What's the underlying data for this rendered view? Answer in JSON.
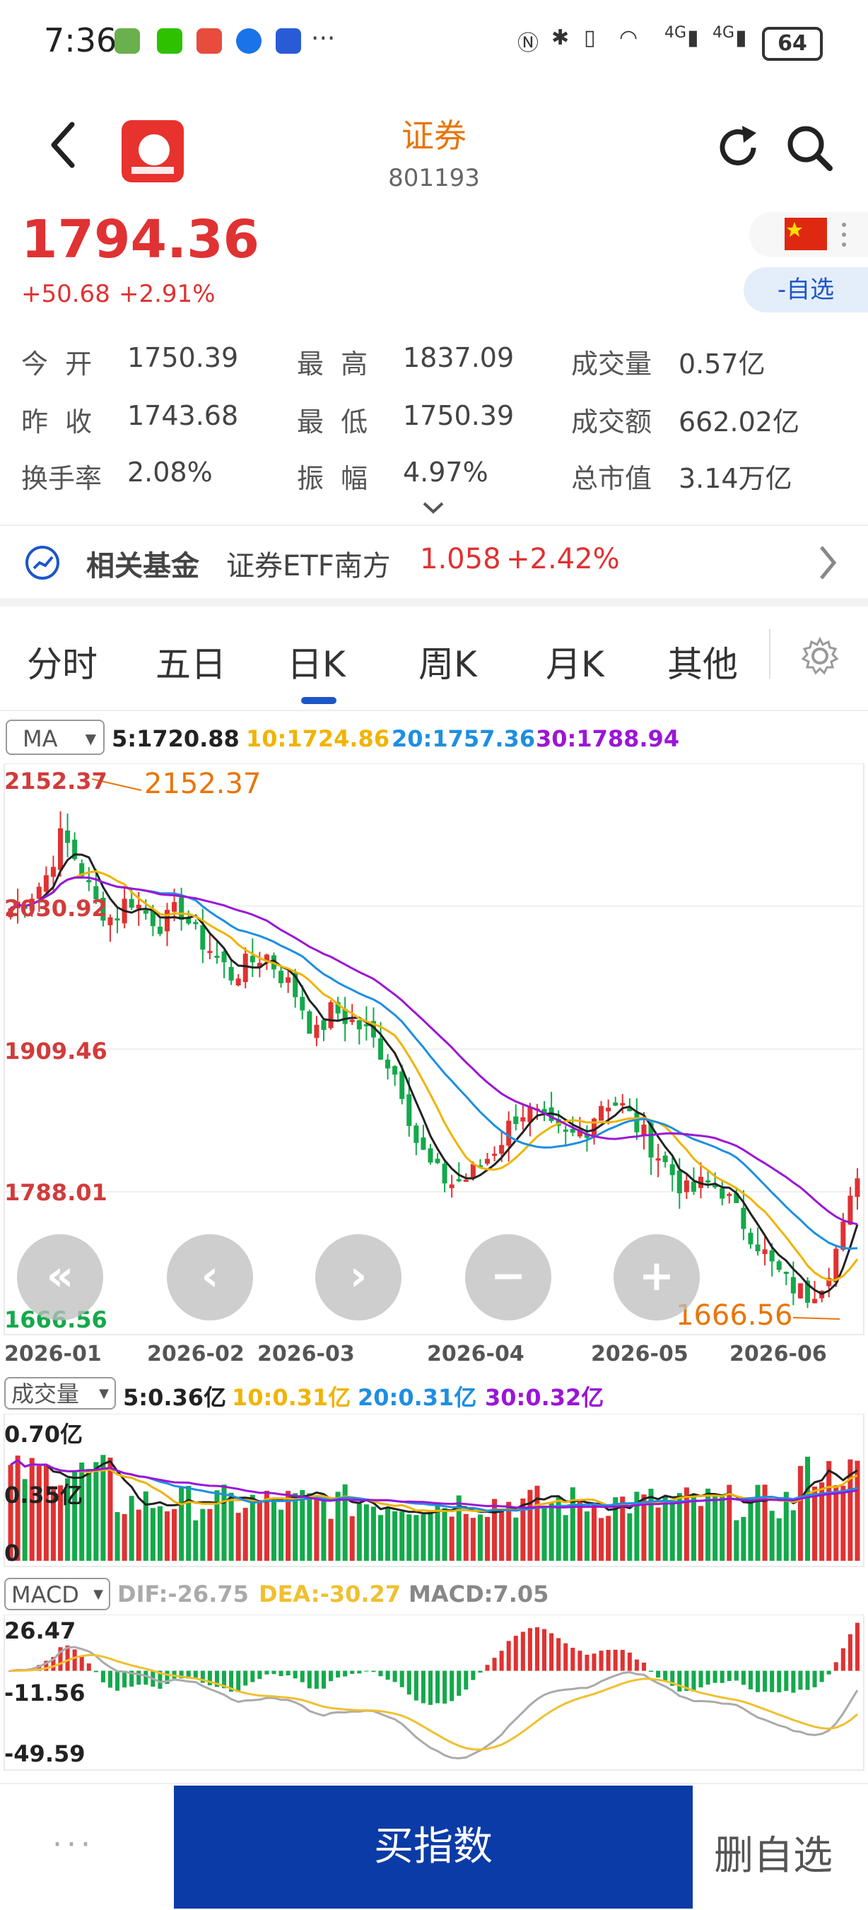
{
  "status": {
    "time": "7:36",
    "more": "···",
    "signal1": "4G",
    "signal2": "4G",
    "battery": "64"
  },
  "header": {
    "title": "证券",
    "code": "801193",
    "brand_color": "#e8750a"
  },
  "quote": {
    "price": "1794.36",
    "change": "+50.68",
    "change_pct": "+2.91%",
    "watch_label": "-自选",
    "up_color": "#e03232",
    "down_color": "#14a94b"
  },
  "stats": [
    {
      "label": "今  开",
      "value": "1750.39"
    },
    {
      "label": "最  高",
      "value": "1837.09"
    },
    {
      "label": "成交量",
      "value": "0.57亿"
    },
    {
      "label": "昨  收",
      "value": "1743.68"
    },
    {
      "label": "最  低",
      "value": "1750.39"
    },
    {
      "label": "成交额",
      "value": "662.02亿"
    },
    {
      "label": "换手率",
      "value": "2.08%"
    },
    {
      "label": "振  幅",
      "value": "4.97%"
    },
    {
      "label": "总市值",
      "value": "3.14万亿"
    }
  ],
  "fund": {
    "label": "相关基金",
    "name": "证券ETF南方",
    "price": "1.058",
    "pct": "+2.42%"
  },
  "tabs": [
    "分时",
    "五日",
    "日K",
    "周K",
    "月K",
    "其他"
  ],
  "active_tab": "日K",
  "ma": {
    "select": "MA",
    "ma5": "5:1720.88",
    "ma10": "10:1724.86",
    "ma20": "20:1757.36",
    "ma30": "30:1788.94",
    "colors": {
      "ma5": "#222222",
      "ma10": "#f0b400",
      "ma20": "#1e8fe0",
      "ma30": "#9b16d6"
    }
  },
  "chart_data": [
    {
      "type": "candlestick",
      "yticks": [
        "2152.37",
        "2030.92",
        "1909.46",
        "1788.01",
        "1666.56"
      ],
      "ylim": [
        1666.56,
        2152.37
      ],
      "xticks": [
        "2026-01",
        "2026-02",
        "2026-03",
        "2026-04",
        "2026-05",
        "2026-06"
      ],
      "annotations": [
        "2152.37",
        "1666.56"
      ],
      "close_trend": [
        2035,
        2045,
        2060,
        2100,
        2075,
        2040,
        2025,
        2045,
        2030,
        2020,
        2035,
        2010,
        1995,
        1975,
        1985,
        1995,
        1975,
        1955,
        1920,
        1945,
        1935,
        1925,
        1905,
        1880,
        1825,
        1800,
        1790,
        1795,
        1810,
        1830,
        1855,
        1850,
        1835,
        1830,
        1840,
        1865,
        1860,
        1840,
        1820,
        1800,
        1780,
        1790,
        1785,
        1760,
        1740,
        1715,
        1700,
        1690,
        1705,
        1740,
        1794
      ]
    },
    {
      "type": "bar",
      "title": "成交量",
      "select": "成交量",
      "legend": {
        "ma5": "5:0.36亿",
        "ma10": "10:0.31亿",
        "ma20": "20:0.31亿",
        "ma30": "30:0.32亿"
      },
      "yticks": [
        "0.70亿",
        "0.35亿",
        "0"
      ],
      "ylim": [
        0,
        0.7
      ]
    },
    {
      "type": "bar",
      "title": "MACD",
      "select": "MACD",
      "legend": {
        "dif": "DIF:-26.75",
        "dea": "DEA:-30.27",
        "macd": "MACD:7.05"
      },
      "yticks": [
        "26.47",
        "-11.56",
        "-49.59"
      ],
      "ylim": [
        -49.59,
        26.47
      ]
    }
  ],
  "nav_buttons": [
    "«",
    "‹",
    "›",
    "−",
    "+"
  ],
  "bottom": {
    "more": "···",
    "buy": "买指数",
    "delete": "删自选"
  }
}
